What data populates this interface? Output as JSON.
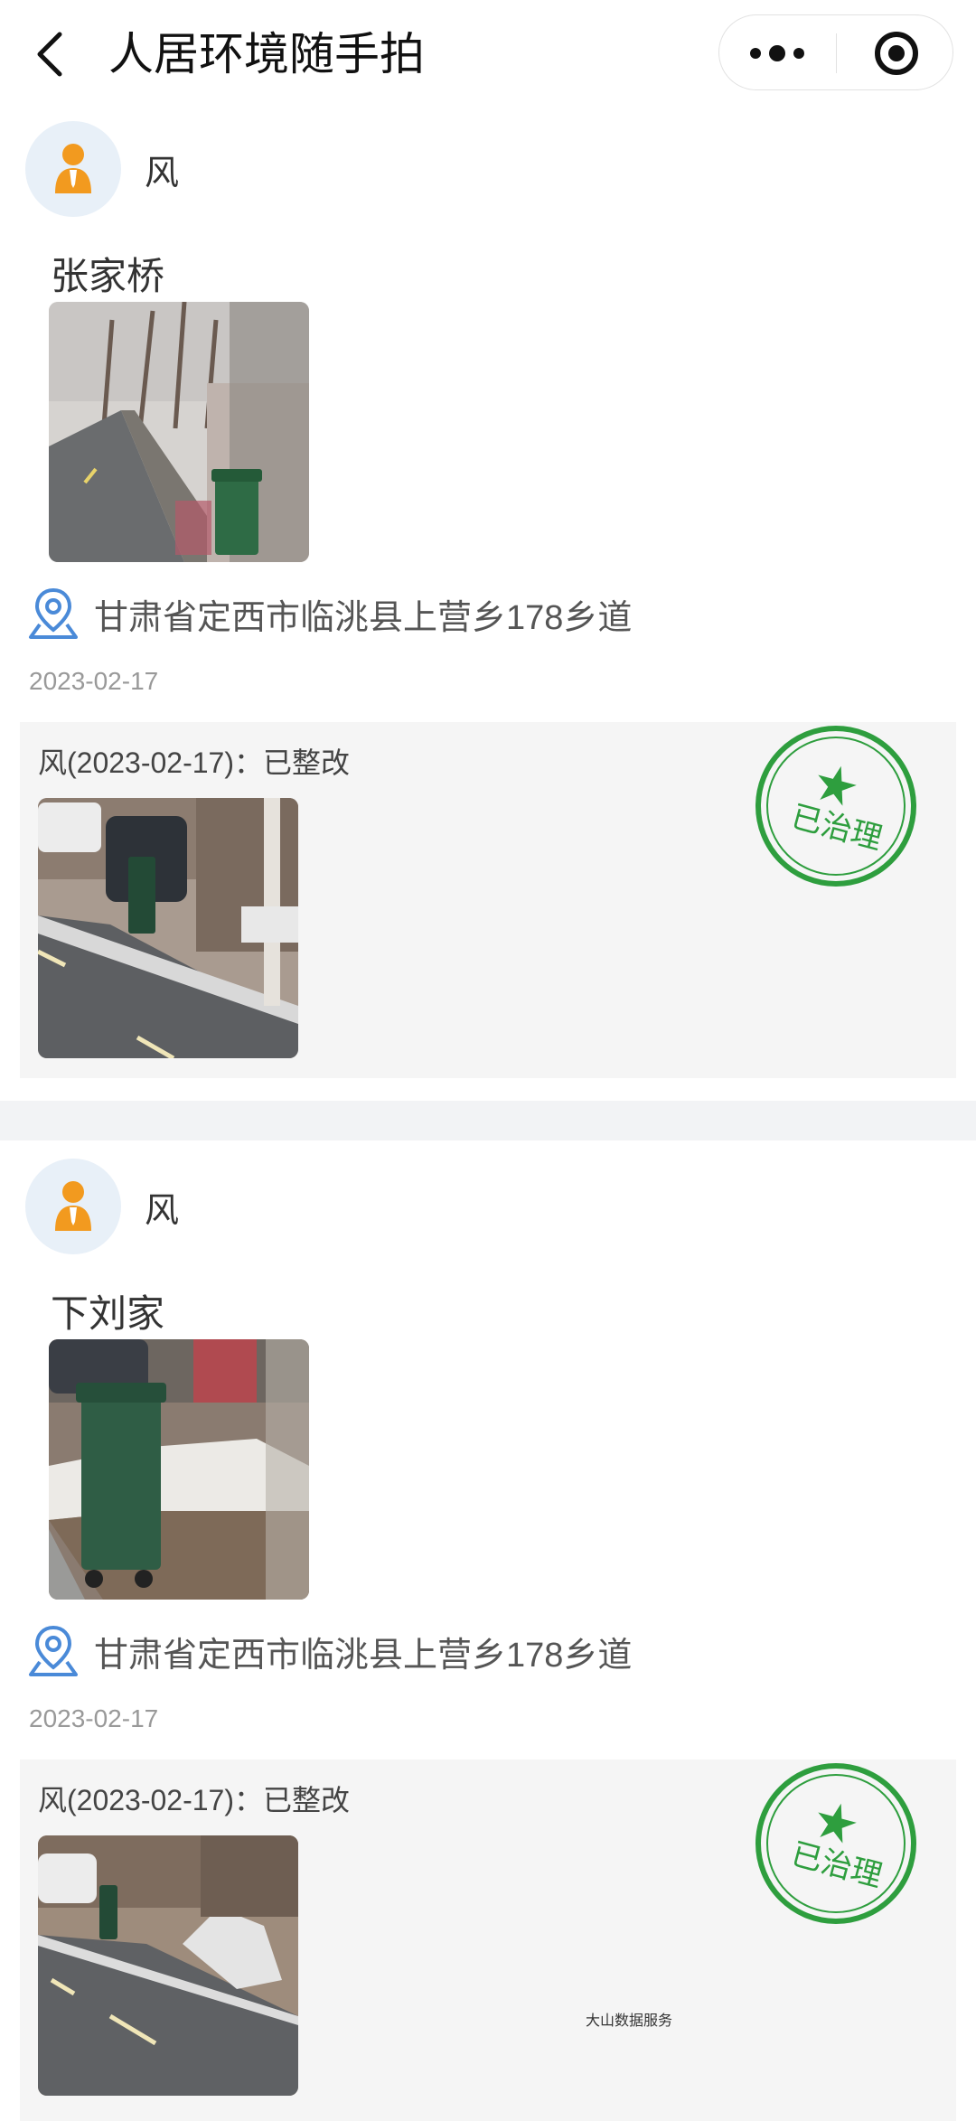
{
  "nav": {
    "title": "人居环境随手拍",
    "back_icon": "chevron-left-icon",
    "more_icon": "more-dots-icon",
    "close_icon": "target-circle-icon"
  },
  "posts": [
    {
      "user": "风",
      "place": "张家桥",
      "address": "甘肃省定西市临洮县上营乡178乡道",
      "date": "2023-02-17",
      "feedback": "风(2023-02-17)：已整改",
      "stamp_text": "已治理",
      "photo": "road-with-green-trash-bin-photo",
      "feedback_photo": "rectified-roadside-photo"
    },
    {
      "user": "风",
      "place": "下刘家",
      "address": "甘肃省定西市临洮县上营乡178乡道",
      "date": "2023-02-17",
      "feedback": "风(2023-02-17)：已整改",
      "stamp_text": "已治理",
      "photo": "trash-bin-snow-photo",
      "feedback_photo": "rectified-village-road-photo"
    }
  ],
  "watermark": "大山数据服务",
  "colors": {
    "stamp_green": "#2e9e3e",
    "avatar_orange": "#f29a1f",
    "location_blue": "#4a8ad8"
  }
}
